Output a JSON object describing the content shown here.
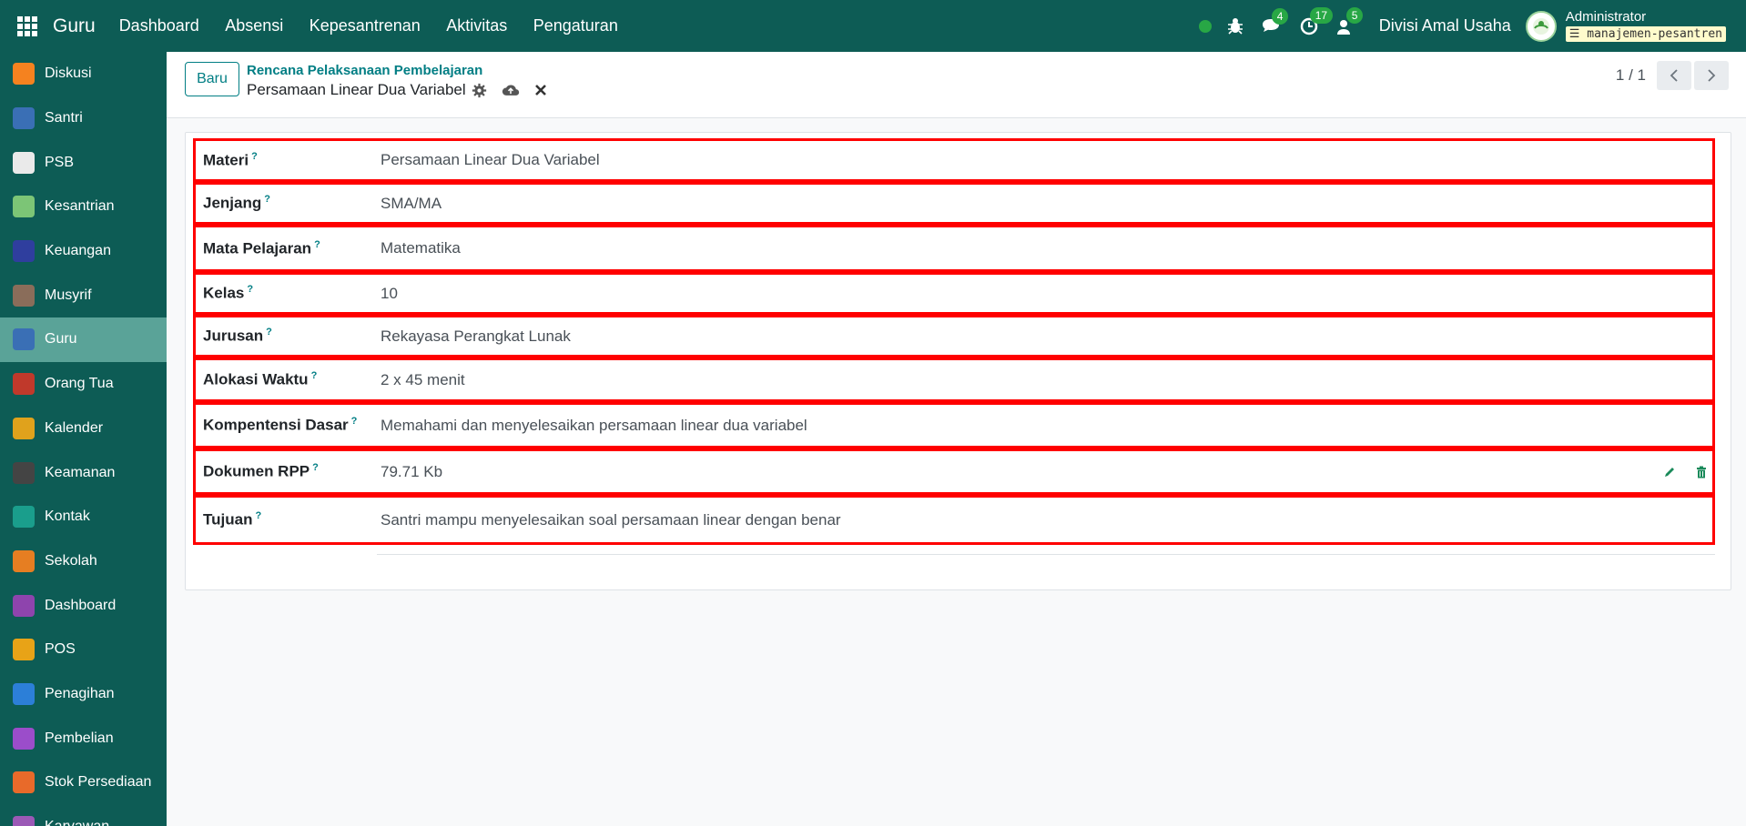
{
  "app": {
    "title": "Guru",
    "nav": [
      "Dashboard",
      "Absensi",
      "Kepesantrenan",
      "Aktivitas",
      "Pengaturan"
    ],
    "badges": {
      "messages": "4",
      "activities": "17",
      "notifications": "5"
    },
    "company": "Divisi Amal Usaha",
    "user": "Administrator",
    "database": "manajemen-pesantren"
  },
  "sidebar": {
    "items": [
      {
        "label": "Diskusi",
        "color": "#f5821f"
      },
      {
        "label": "Santri",
        "color": "#3a6fb5"
      },
      {
        "label": "PSB",
        "color": "#eaeaea"
      },
      {
        "label": "Kesantrian",
        "color": "#7cc576"
      },
      {
        "label": "Keuangan",
        "color": "#2f3e9e"
      },
      {
        "label": "Musyrif",
        "color": "#8a6d5a"
      },
      {
        "label": "Guru",
        "color": "#3a6fb5"
      },
      {
        "label": "Orang Tua",
        "color": "#c0392b"
      },
      {
        "label": "Kalender",
        "color": "#e0a21c"
      },
      {
        "label": "Keamanan",
        "color": "#444444"
      },
      {
        "label": "Kontak",
        "color": "#1a9e8c"
      },
      {
        "label": "Sekolah",
        "color": "#e67e22"
      },
      {
        "label": "Dashboard",
        "color": "#8e44ad"
      },
      {
        "label": "POS",
        "color": "#e8a317"
      },
      {
        "label": "Penagihan",
        "color": "#2c7fd8"
      },
      {
        "label": "Pembelian",
        "color": "#9b4dca"
      },
      {
        "label": "Stok Persediaan",
        "color": "#e86a2a"
      },
      {
        "label": "Karyawan",
        "color": "#9b59b6"
      }
    ],
    "active_index": 6
  },
  "control": {
    "new_label": "Baru",
    "breadcrumb_parent": "Rencana Pelaksanaan Pembelajaran",
    "breadcrumb_current": "Persamaan Linear Dua Variabel",
    "pager": "1 / 1"
  },
  "form": {
    "help_mark": "?",
    "fields": [
      {
        "label": "Materi",
        "value": "Persamaan Linear Dua Variabel"
      },
      {
        "label": "Jenjang",
        "value": "SMA/MA"
      },
      {
        "label": "Mata Pelajaran",
        "value": "Matematika"
      },
      {
        "label": "Kelas",
        "value": "10"
      },
      {
        "label": "Jurusan",
        "value": "Rekayasa Perangkat Lunak"
      },
      {
        "label": "Alokasi Waktu",
        "value": "2 x 45 menit"
      },
      {
        "label": "Kompentensi Dasar",
        "value": "Memahami dan menyelesaikan persamaan linear dua variabel"
      },
      {
        "label": "Dokumen RPP",
        "value": "79.71 Kb"
      },
      {
        "label": "Tujuan",
        "value": "Santri mampu menyelesaikan soal persamaan linear dengan benar"
      }
    ]
  },
  "colors": {
    "primary": "#0d5c55",
    "accent": "#017e84",
    "highlight": "#ff0000"
  }
}
